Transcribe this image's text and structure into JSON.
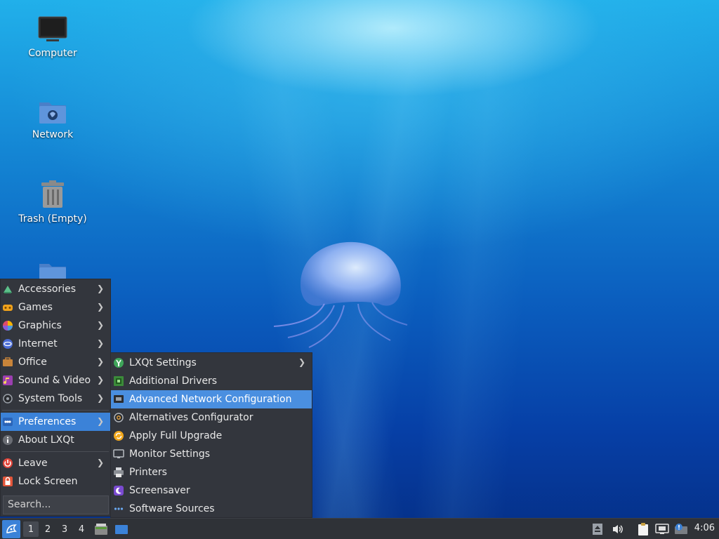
{
  "desktop": {
    "icons": [
      {
        "label": "Computer",
        "icon": "computer-icon"
      },
      {
        "label": "Network",
        "icon": "network-folder-icon"
      },
      {
        "label": "Trash (Empty)",
        "icon": "trash-icon"
      },
      {
        "label": "",
        "icon": "folder-icon"
      }
    ]
  },
  "menu": {
    "items": [
      {
        "label": "Accessories",
        "icon": "accessories-icon",
        "submenu": true
      },
      {
        "label": "Games",
        "icon": "games-icon",
        "submenu": true
      },
      {
        "label": "Graphics",
        "icon": "graphics-icon",
        "submenu": true
      },
      {
        "label": "Internet",
        "icon": "internet-icon",
        "submenu": true
      },
      {
        "label": "Office",
        "icon": "office-icon",
        "submenu": true
      },
      {
        "label": "Sound & Video",
        "icon": "sound-video-icon",
        "submenu": true
      },
      {
        "label": "System Tools",
        "icon": "system-tools-icon",
        "submenu": true
      },
      {
        "label": "Preferences",
        "icon": "preferences-icon",
        "submenu": true,
        "active": true
      },
      {
        "label": "About LXQt",
        "icon": "about-icon",
        "submenu": false
      },
      {
        "label": "Leave",
        "icon": "leave-icon",
        "submenu": true
      },
      {
        "label": "Lock Screen",
        "icon": "lock-icon",
        "submenu": false
      }
    ],
    "search_placeholder": "Search..."
  },
  "submenu": {
    "items": [
      {
        "label": "LXQt Settings",
        "icon": "lxqt-settings-icon",
        "submenu": true
      },
      {
        "label": "Additional Drivers",
        "icon": "drivers-icon"
      },
      {
        "label": "Advanced Network Configuration",
        "icon": "network-config-icon",
        "active": true
      },
      {
        "label": "Alternatives Configurator",
        "icon": "alternatives-icon"
      },
      {
        "label": "Apply Full Upgrade",
        "icon": "upgrade-icon"
      },
      {
        "label": "Monitor Settings",
        "icon": "monitor-icon"
      },
      {
        "label": "Printers",
        "icon": "printer-icon"
      },
      {
        "label": "Screensaver",
        "icon": "screensaver-icon"
      },
      {
        "label": "Software Sources",
        "icon": "software-sources-icon"
      }
    ]
  },
  "taskbar": {
    "workspaces": [
      "1",
      "2",
      "3",
      "4"
    ],
    "active_workspace": "1",
    "clock": "4:06"
  },
  "colors": {
    "menu_bg": "#33363d",
    "highlight": "#3b82d8",
    "taskbar_bg": "#2f3237"
  }
}
